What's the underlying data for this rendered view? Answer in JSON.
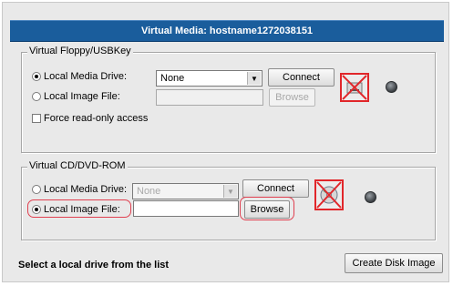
{
  "window": {
    "title": "Virtual Media: hostname1272038151"
  },
  "floppy": {
    "legend": "Virtual Floppy/USBKey",
    "local_media_drive_label": "Local Media Drive:",
    "local_media_drive_selected": "None",
    "connect_label": "Connect",
    "local_image_file_label": "Local Image File:",
    "image_path_value": "",
    "browse_label": "Browse",
    "force_readonly_label": "Force read-only access",
    "mode": "local_media_drive",
    "drive_icon": "disconnected-drive-icon",
    "led_icon": "status-led-icon"
  },
  "cdrom": {
    "legend": "Virtual CD/DVD-ROM",
    "local_media_drive_label": "Local Media Drive:",
    "local_media_drive_selected": "None",
    "connect_label": "Connect",
    "local_image_file_label": "Local Image File:",
    "image_path_value": "",
    "browse_label": "Browse",
    "mode": "local_image_file",
    "drive_icon": "disconnected-disc-icon",
    "led_icon": "status-led-icon"
  },
  "footer": {
    "status": "Select a local drive from the list",
    "create_disk_image_label": "Create Disk Image"
  },
  "colors": {
    "title_bar": "#1a5d9c",
    "highlight": "#e04050",
    "disconnect_x": "#e1262a"
  }
}
